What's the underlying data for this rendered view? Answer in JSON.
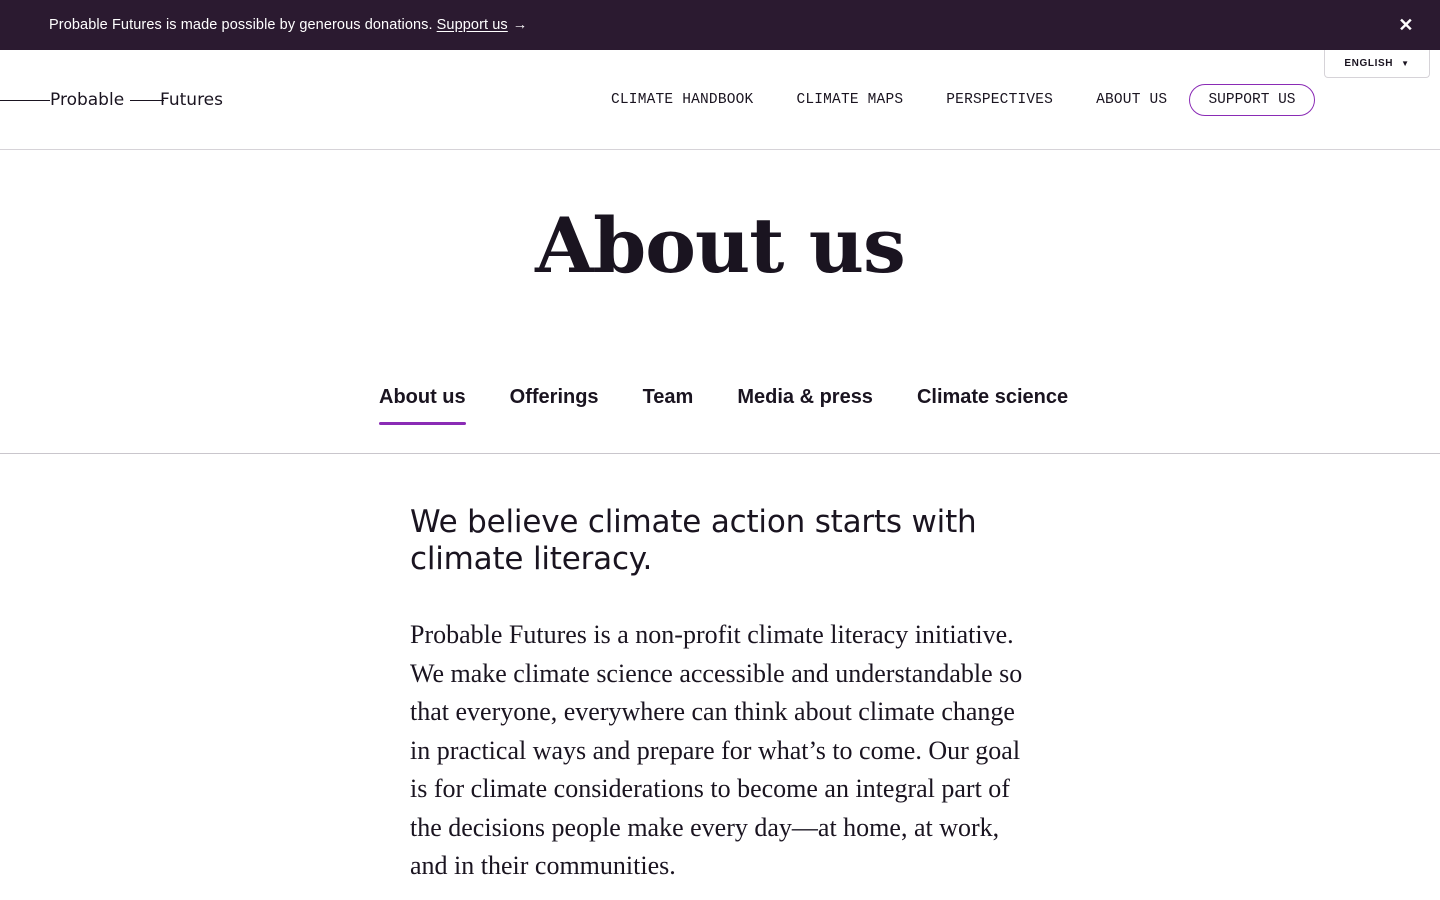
{
  "banner": {
    "text": "Probable Futures is made possible by generous donations.",
    "link_label": "Support us",
    "arrow": "→",
    "close_glyph": "✕"
  },
  "header": {
    "logo": {
      "word1": "Probable",
      "word2": "Futures"
    },
    "nav": [
      {
        "label": "CLIMATE HANDBOOK"
      },
      {
        "label": "CLIMATE MAPS"
      },
      {
        "label": "PERSPECTIVES"
      },
      {
        "label": "ABOUT US"
      }
    ],
    "support_button": "SUPPORT US",
    "language": {
      "label": "ENGLISH",
      "caret": "▼"
    }
  },
  "page": {
    "title": "About us",
    "tabs": [
      {
        "label": "About us",
        "active": true
      },
      {
        "label": "Offerings",
        "active": false
      },
      {
        "label": "Team",
        "active": false
      },
      {
        "label": "Media & press",
        "active": false
      },
      {
        "label": "Climate science",
        "active": false
      }
    ],
    "lede": "We believe climate action starts with climate literacy.",
    "body": "Probable Futures is a non-profit climate literacy initiative. We make climate science accessible and understandable so that everyone, everywhere can think about climate change in practical ways and prepare for what’s to come. Our goal is for climate considerations to become an integral part of the decisions people make every day—at home, at work, and in their communities."
  },
  "colors": {
    "banner_bg": "#2b1a30",
    "accent": "#8a2bb5",
    "text": "#1a1420"
  }
}
